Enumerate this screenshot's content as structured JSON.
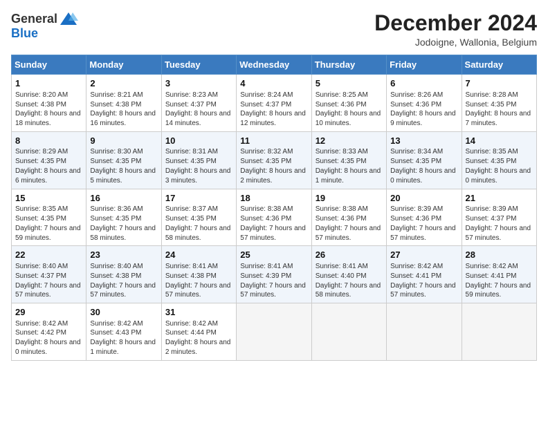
{
  "logo": {
    "general": "General",
    "blue": "Blue"
  },
  "header": {
    "month": "December 2024",
    "location": "Jodoigne, Wallonia, Belgium"
  },
  "weekdays": [
    "Sunday",
    "Monday",
    "Tuesday",
    "Wednesday",
    "Thursday",
    "Friday",
    "Saturday"
  ],
  "weeks": [
    [
      {
        "day": "1",
        "sunrise": "8:20 AM",
        "sunset": "4:38 PM",
        "daylight": "8 hours and 18 minutes."
      },
      {
        "day": "2",
        "sunrise": "8:21 AM",
        "sunset": "4:38 PM",
        "daylight": "8 hours and 16 minutes."
      },
      {
        "day": "3",
        "sunrise": "8:23 AM",
        "sunset": "4:37 PM",
        "daylight": "8 hours and 14 minutes."
      },
      {
        "day": "4",
        "sunrise": "8:24 AM",
        "sunset": "4:37 PM",
        "daylight": "8 hours and 12 minutes."
      },
      {
        "day": "5",
        "sunrise": "8:25 AM",
        "sunset": "4:36 PM",
        "daylight": "8 hours and 10 minutes."
      },
      {
        "day": "6",
        "sunrise": "8:26 AM",
        "sunset": "4:36 PM",
        "daylight": "8 hours and 9 minutes."
      },
      {
        "day": "7",
        "sunrise": "8:28 AM",
        "sunset": "4:35 PM",
        "daylight": "8 hours and 7 minutes."
      }
    ],
    [
      {
        "day": "8",
        "sunrise": "8:29 AM",
        "sunset": "4:35 PM",
        "daylight": "8 hours and 6 minutes."
      },
      {
        "day": "9",
        "sunrise": "8:30 AM",
        "sunset": "4:35 PM",
        "daylight": "8 hours and 5 minutes."
      },
      {
        "day": "10",
        "sunrise": "8:31 AM",
        "sunset": "4:35 PM",
        "daylight": "8 hours and 3 minutes."
      },
      {
        "day": "11",
        "sunrise": "8:32 AM",
        "sunset": "4:35 PM",
        "daylight": "8 hours and 2 minutes."
      },
      {
        "day": "12",
        "sunrise": "8:33 AM",
        "sunset": "4:35 PM",
        "daylight": "8 hours and 1 minute."
      },
      {
        "day": "13",
        "sunrise": "8:34 AM",
        "sunset": "4:35 PM",
        "daylight": "8 hours and 0 minutes."
      },
      {
        "day": "14",
        "sunrise": "8:35 AM",
        "sunset": "4:35 PM",
        "daylight": "8 hours and 0 minutes."
      }
    ],
    [
      {
        "day": "15",
        "sunrise": "8:35 AM",
        "sunset": "4:35 PM",
        "daylight": "7 hours and 59 minutes."
      },
      {
        "day": "16",
        "sunrise": "8:36 AM",
        "sunset": "4:35 PM",
        "daylight": "7 hours and 58 minutes."
      },
      {
        "day": "17",
        "sunrise": "8:37 AM",
        "sunset": "4:35 PM",
        "daylight": "7 hours and 58 minutes."
      },
      {
        "day": "18",
        "sunrise": "8:38 AM",
        "sunset": "4:36 PM",
        "daylight": "7 hours and 57 minutes."
      },
      {
        "day": "19",
        "sunrise": "8:38 AM",
        "sunset": "4:36 PM",
        "daylight": "7 hours and 57 minutes."
      },
      {
        "day": "20",
        "sunrise": "8:39 AM",
        "sunset": "4:36 PM",
        "daylight": "7 hours and 57 minutes."
      },
      {
        "day": "21",
        "sunrise": "8:39 AM",
        "sunset": "4:37 PM",
        "daylight": "7 hours and 57 minutes."
      }
    ],
    [
      {
        "day": "22",
        "sunrise": "8:40 AM",
        "sunset": "4:37 PM",
        "daylight": "7 hours and 57 minutes."
      },
      {
        "day": "23",
        "sunrise": "8:40 AM",
        "sunset": "4:38 PM",
        "daylight": "7 hours and 57 minutes."
      },
      {
        "day": "24",
        "sunrise": "8:41 AM",
        "sunset": "4:38 PM",
        "daylight": "7 hours and 57 minutes."
      },
      {
        "day": "25",
        "sunrise": "8:41 AM",
        "sunset": "4:39 PM",
        "daylight": "7 hours and 57 minutes."
      },
      {
        "day": "26",
        "sunrise": "8:41 AM",
        "sunset": "4:40 PM",
        "daylight": "7 hours and 58 minutes."
      },
      {
        "day": "27",
        "sunrise": "8:42 AM",
        "sunset": "4:41 PM",
        "daylight": "7 hours and 57 minutes."
      },
      {
        "day": "28",
        "sunrise": "8:42 AM",
        "sunset": "4:41 PM",
        "daylight": "7 hours and 59 minutes."
      }
    ],
    [
      {
        "day": "29",
        "sunrise": "8:42 AM",
        "sunset": "4:42 PM",
        "daylight": "8 hours and 0 minutes."
      },
      {
        "day": "30",
        "sunrise": "8:42 AM",
        "sunset": "4:43 PM",
        "daylight": "8 hours and 1 minute."
      },
      {
        "day": "31",
        "sunrise": "8:42 AM",
        "sunset": "4:44 PM",
        "daylight": "8 hours and 2 minutes."
      },
      null,
      null,
      null,
      null
    ]
  ],
  "labels": {
    "sunrise": "Sunrise:",
    "sunset": "Sunset:",
    "daylight": "Daylight:"
  }
}
